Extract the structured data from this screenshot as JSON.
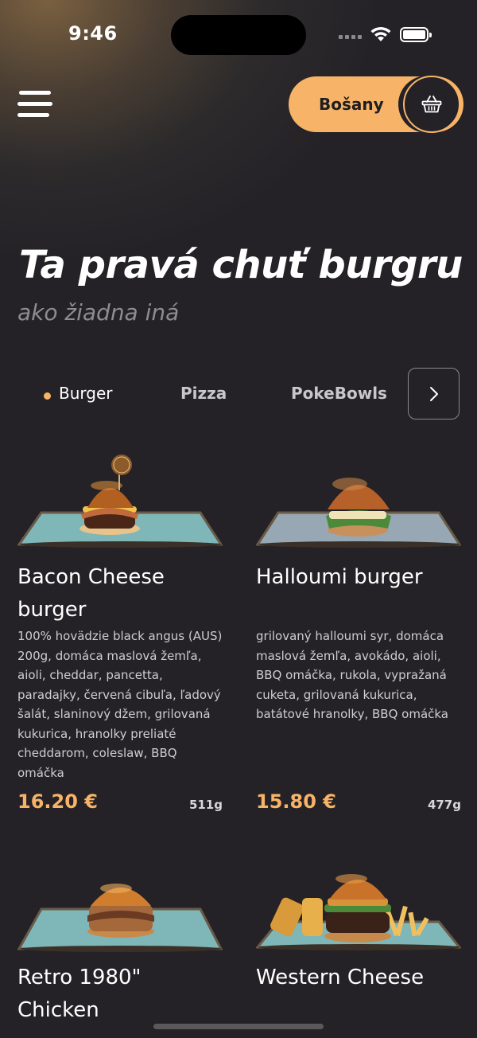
{
  "status_bar": {
    "time": "9:46"
  },
  "header": {
    "location": "Bošany",
    "menu_icon": "hamburger-icon",
    "cart_icon": "basket-icon"
  },
  "hero": {
    "title": "Ta pravá chuť burgru",
    "subtitle": "ako žiadna iná"
  },
  "tabs": [
    {
      "label": "Burger",
      "active": true
    },
    {
      "label": "Pizza",
      "active": false
    },
    {
      "label": "PokeBowls",
      "active": false
    }
  ],
  "products": [
    {
      "name": "Bacon Cheese burger",
      "description": "100% hovädzie black angus (AUS) 200g, domáca maslová žemľa, aioli, cheddar, pancetta, paradajky, červená cibuľa, ľadový šalát, slaninový džem, grilovaná kukurica, hranolky preliaté cheddarom, coleslaw, BBQ omáčka",
      "price": "16.20 €",
      "weight": "511g"
    },
    {
      "name": "Halloumi burger",
      "description": "grilovaný halloumi syr, domáca maslová žemľa, avokádo, aioli, BBQ omáčka, rukola, vypražaná cuketa, grilovaná kukurica, batátové hranolky, BBQ omáčka",
      "price": "15.80 €",
      "weight": "477g"
    },
    {
      "name": "Retro 1980\" Chicken"
    },
    {
      "name": "Western Cheese"
    }
  ],
  "colors": {
    "accent": "#f7b468",
    "background": "#242226",
    "plate": "#7fb6b8"
  }
}
